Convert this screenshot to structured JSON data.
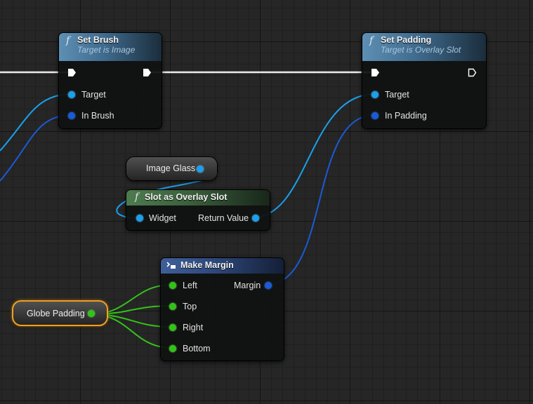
{
  "nodes": {
    "set_brush": {
      "title": "Set Brush",
      "subtitle": "Target is Image",
      "pins": {
        "target": "Target",
        "in_brush": "In Brush"
      }
    },
    "set_padding": {
      "title": "Set Padding",
      "subtitle": "Target is Overlay Slot",
      "pins": {
        "target": "Target",
        "in_padding": "In Padding"
      }
    },
    "image_glass": {
      "label": "Image Glass"
    },
    "slot_cast": {
      "title": "Slot as Overlay Slot",
      "pins": {
        "widget": "Widget",
        "return_value": "Return Value"
      }
    },
    "make_margin": {
      "title": "Make Margin",
      "pins": {
        "left": "Left",
        "top": "Top",
        "right": "Right",
        "bottom": "Bottom",
        "margin": "Margin"
      }
    },
    "globe_padding": {
      "label": "Globe Padding"
    }
  },
  "icons": {
    "function": "f",
    "make_struct": "make-struct-icon"
  },
  "colors": {
    "object_pin": "#1aa0ec",
    "struct_pin": "#1a5bd6",
    "float_pin": "#34c21a",
    "exec_wire": "#ffffff",
    "selection_outline": "#f0a020",
    "graph_background": "#262626"
  }
}
